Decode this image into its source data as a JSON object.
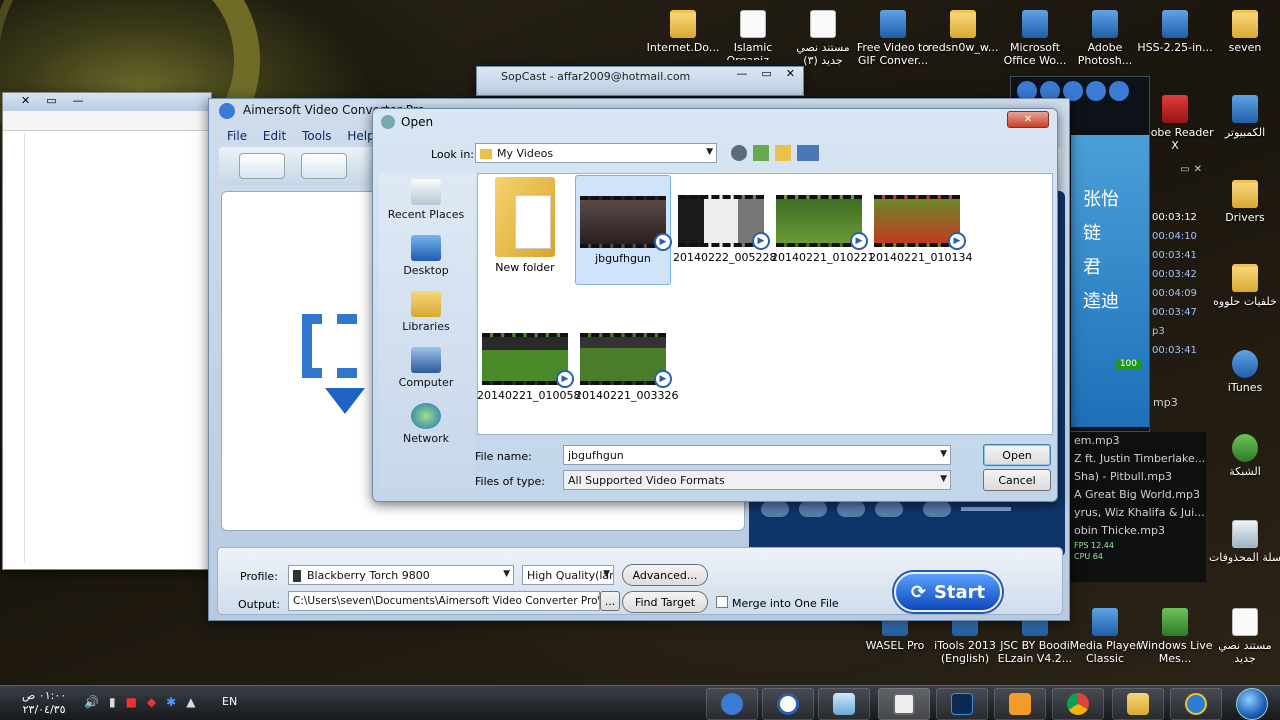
{
  "desktop_icons": [
    {
      "label": "Internet.Do...",
      "icon": "folder-icon",
      "name": "desktop-icon-internet-do"
    },
    {
      "label": "Islamic Organiz...",
      "icon": "document-icon",
      "name": "desktop-icon-islamic-organiz"
    },
    {
      "label": "مستند نصي جديد (٣)",
      "icon": "document-icon",
      "name": "desktop-icon-text-doc-3"
    },
    {
      "label": "Free Video to GIF Conver...",
      "icon": "app-icon",
      "name": "desktop-icon-free-video-gif"
    },
    {
      "label": "redsn0w_w...",
      "icon": "folder-icon",
      "name": "desktop-icon-redsn0w"
    },
    {
      "label": "Microsoft Office Wo...",
      "icon": "app-icon",
      "name": "desktop-icon-office-word"
    },
    {
      "label": "Adobe Photosh...",
      "icon": "app-icon",
      "name": "desktop-icon-photoshop"
    },
    {
      "label": "HSS-2.25-in...",
      "icon": "shield-icon",
      "name": "desktop-icon-hss"
    },
    {
      "label": "seven",
      "icon": "folder-icon",
      "name": "desktop-icon-seven"
    },
    {
      "label": "Adobe Reader X",
      "icon": "pdf-icon",
      "name": "desktop-icon-adobe-reader"
    },
    {
      "label": "الكمبيوتر",
      "icon": "computer-icon",
      "name": "desktop-icon-computer"
    },
    {
      "label": "Drivers",
      "icon": "folder-icon",
      "name": "desktop-icon-drivers"
    },
    {
      "label": "خلفيات حلووه",
      "icon": "folder-icon",
      "name": "desktop-icon-wallpapers"
    },
    {
      "label": "iTunes",
      "icon": "music-icon",
      "name": "desktop-icon-itunes"
    },
    {
      "label": "الشبكة",
      "icon": "network-icon",
      "name": "desktop-icon-network"
    },
    {
      "label": "سلة المحذوفات",
      "icon": "recycle-bin-icon",
      "name": "desktop-icon-recycle-bin"
    },
    {
      "label": "مستند نصي جديد",
      "icon": "document-icon",
      "name": "desktop-icon-text-doc"
    },
    {
      "label": "WASEL Pro",
      "icon": "app-icon",
      "name": "desktop-icon-wasel"
    },
    {
      "label": "iTools 2013 (English)",
      "icon": "app-icon",
      "name": "desktop-icon-itools"
    },
    {
      "label": "JSC BY Boodi ELzain V4.2...",
      "icon": "app-icon",
      "name": "desktop-icon-jsc"
    },
    {
      "label": "Media Player Classic",
      "icon": "app-icon",
      "name": "desktop-icon-media-player"
    },
    {
      "label": "Windows Live Mes...",
      "icon": "app-icon",
      "name": "desktop-icon-live-messenger"
    }
  ],
  "sopcast": {
    "title": "SopCast - affar2009@hotmail.com"
  },
  "player": {
    "times": [
      "00:03:12",
      "00:04:10",
      "00:03:41",
      "00:03:42",
      "00:04:09",
      "00:03:47",
      "p3",
      "00:03:41"
    ],
    "chinese": [
      "张怡",
      "链",
      "君",
      "逵迪"
    ],
    "badge": "100",
    "fps": "FPS 12.44",
    "cpu": "CPU 64",
    "playlist": [
      "em.mp3",
      "Z ft. Justin Timberlake...",
      "Sha) - Pitbull.mp3",
      "A Great Big World.mp3",
      "yrus, Wiz Khalifa & Jui...",
      "obin Thicke.mp3",
      "mp3"
    ]
  },
  "aimersoft": {
    "title": "Aimersoft Video Converter Pro",
    "menu": [
      "File",
      "Edit",
      "Tools",
      "Help"
    ],
    "profile_label": "Profile:",
    "profile_value": "Blackberry Torch 9800",
    "quality_value": "High Quality(lar",
    "advanced": "Advanced...",
    "output_label": "Output:",
    "output_value": "C:\\Users\\seven\\Documents\\Aimersoft Video Converter Pro\\Output",
    "browse": "...",
    "find_target": "Find Target",
    "merge": "Merge into One File",
    "start": "Start"
  },
  "open_dialog": {
    "title": "Open",
    "look_in_label": "Look in:",
    "look_in_value": "My Videos",
    "places": [
      {
        "label": "Recent Places",
        "icon": "recent-places-icon"
      },
      {
        "label": "Desktop",
        "icon": "desktop-icon"
      },
      {
        "label": "Libraries",
        "icon": "libraries-icon"
      },
      {
        "label": "Computer",
        "icon": "computer-icon"
      },
      {
        "label": "Network",
        "icon": "network-icon"
      }
    ],
    "files": [
      {
        "name": "New folder",
        "type": "folder"
      },
      {
        "name": "jbgufhgun",
        "type": "video",
        "selected": true
      },
      {
        "name": "20140222_005228",
        "type": "video"
      },
      {
        "name": "20140221_010221",
        "type": "video"
      },
      {
        "name": "20140221_010134",
        "type": "video"
      },
      {
        "name": "20140221_010058",
        "type": "video"
      },
      {
        "name": "20140221_003326",
        "type": "video"
      }
    ],
    "file_name_label": "File name:",
    "file_name_value": "jbgufhgun",
    "file_type_label": "Files of type:",
    "file_type_value": "All Supported Video Formats",
    "open_button": "Open",
    "cancel_button": "Cancel"
  },
  "taskbar": {
    "time": "٠١:٠٠ ص",
    "date": "٢٣/٠٤/٣٥",
    "lang": "EN"
  }
}
